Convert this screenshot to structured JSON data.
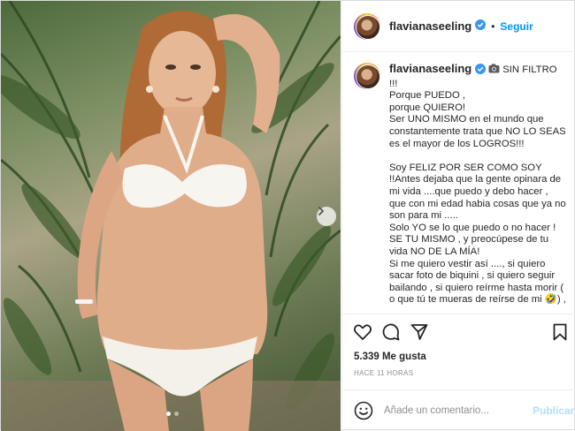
{
  "post": {
    "username": "flavianaseeling",
    "follow_label": "Seguir",
    "separator": "•",
    "media": {
      "slide_count": 2,
      "active_slide": 1
    },
    "caption": {
      "username": "flavianaseeling",
      "first_line": "SIN FILTRO !!!",
      "body": "Porque PUEDO ,\nporque QUIERO!\nSer UNO MISMO en el mundo que constantemente trata que NO LO SEAS es el mayor de los LOGROS!!!\n\nSoy FELIZ POR SER COMO SOY !!Antes dejaba que la gente opinara de mi vida ....que puedo y debo hacer , que con mi edad habia cosas que ya no son para mi .....\nSolo YO se lo que puedo o no hacer !\nSE TU MISMO , y preocúpese de tu vida NO DE LA MÍA!\nSi me quiero vestir así ...., si quiero sacar foto de biquini , si quiero seguir bailando , si quiero reírme hasta morir ( o que tú te mueras de reírse de mi 🤣) ,"
    },
    "likes": "5.339 Me gusta",
    "timestamp": "HACE 11 HORAS",
    "comment": {
      "placeholder": "Añade un comentario...",
      "post_label": "Publicar"
    },
    "icons": {
      "like": "heart-icon",
      "comment": "comment-icon",
      "share": "paper-plane-icon",
      "save": "bookmark-icon",
      "emoji": "smile-icon",
      "verified": "verified-badge-icon",
      "camera": "camera-emoji-icon",
      "next": "chevron-right-icon"
    },
    "colors": {
      "link_blue": "#0095f6",
      "verified_blue": "#3897f0",
      "muted": "#8e8e8e",
      "publish_disabled": "#b2dffc"
    }
  }
}
